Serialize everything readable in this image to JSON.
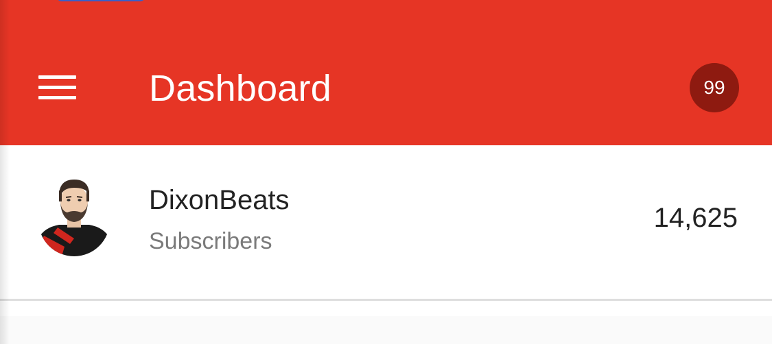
{
  "header": {
    "title": "Dashboard",
    "notification_count": "99",
    "menu_icon": "hamburger-menu-icon",
    "bar_color": "#e63525",
    "badge_color": "#8e1a10"
  },
  "channel": {
    "name": "Dixon⁠Beats",
    "subtitle": "Subscribers",
    "subscriber_count": "14,625",
    "avatar_icon": "channel-avatar"
  }
}
